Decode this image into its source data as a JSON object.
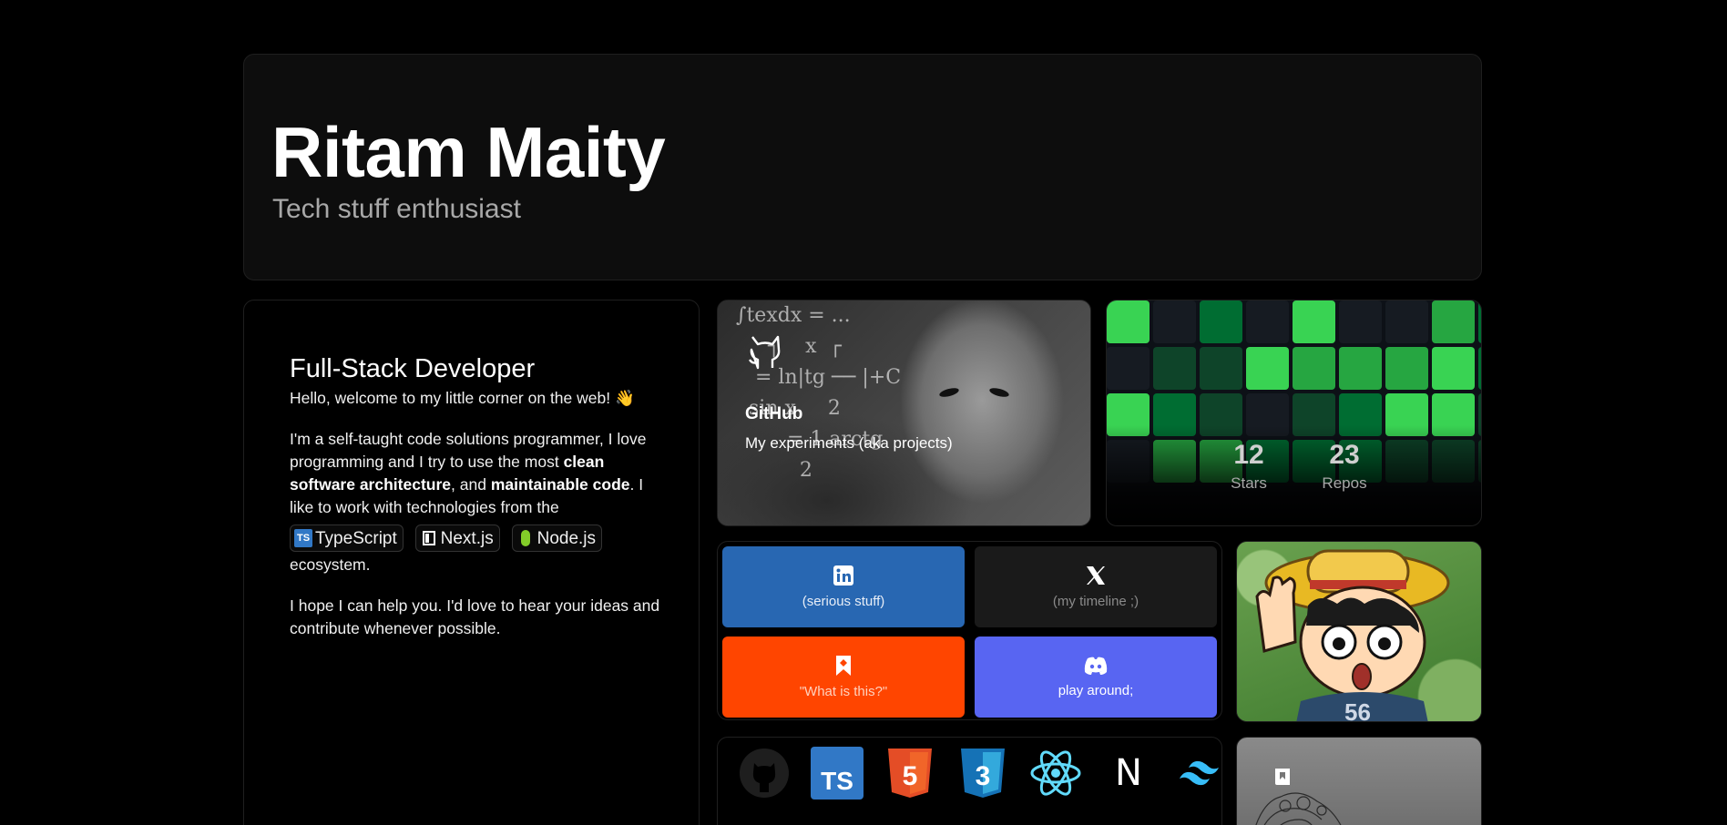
{
  "header": {
    "name": "Ritam Maity",
    "tagline": "Tech stuff enthusiast"
  },
  "about": {
    "role": "Full-Stack Developer",
    "greeting": "Hello, welcome to my little corner on the web! 👋",
    "intro_1": "I'm a self-taught code solutions programmer, I love programming and I try to use the most ",
    "bold_1": "clean software architecture",
    "intro_2": ", and ",
    "bold_2": "maintainable code",
    "intro_3": ". I like to work with technologies from the",
    "chips": [
      {
        "label": "TypeScript",
        "icon": "typescript-icon",
        "color": "#3178c6"
      },
      {
        "label": "Next.js",
        "icon": "nextjs-icon",
        "color": "#ffffff"
      },
      {
        "label": "Node.js",
        "icon": "nodejs-icon",
        "color": "#83cd29"
      }
    ],
    "after_chips": "ecosystem.",
    "closing": "I hope I can help you. I'd love to hear your ideas and contribute whenever possible."
  },
  "github": {
    "title": "GitHub",
    "subtitle": "My experiments (aka projects)",
    "icon": "github-cat-icon"
  },
  "contributions": {
    "stars_value": "12",
    "stars_label": "Stars",
    "repos_value": "23",
    "repos_label": "Repos",
    "levels": [
      [
        4,
        0,
        2,
        0,
        4,
        0,
        0,
        3,
        2
      ],
      [
        0,
        1,
        1,
        4,
        3,
        3,
        3,
        4,
        2
      ],
      [
        4,
        2,
        1,
        0,
        1,
        2,
        4,
        4,
        1
      ],
      [
        0,
        3,
        3,
        2,
        2,
        2,
        1,
        1,
        1
      ]
    ],
    "colors": [
      "#161b22",
      "#0e4429",
      "#006d32",
      "#26a641",
      "#39d353"
    ]
  },
  "socials": {
    "linkedin": {
      "label": "(serious stuff)",
      "icon": "linkedin-icon",
      "color": "#2867b2"
    },
    "x": {
      "label": "(my timeline ;)",
      "icon": "x-icon",
      "color": "#1a1a1a"
    },
    "bookmark": {
      "label": "\"What is this?\"",
      "icon": "bookmark-icon",
      "color": "#ff4500"
    },
    "discord": {
      "label": "play around;",
      "icon": "discord-icon",
      "color": "#5865f2"
    }
  },
  "tech": {
    "icons": [
      "github-icon",
      "typescript-icon",
      "html5-icon",
      "css3-icon",
      "react-icon",
      "nextjs-icon",
      "tailwind-icon"
    ],
    "ts_text": "TS",
    "html_text": "5",
    "css_text": "3",
    "next_text": "N"
  }
}
